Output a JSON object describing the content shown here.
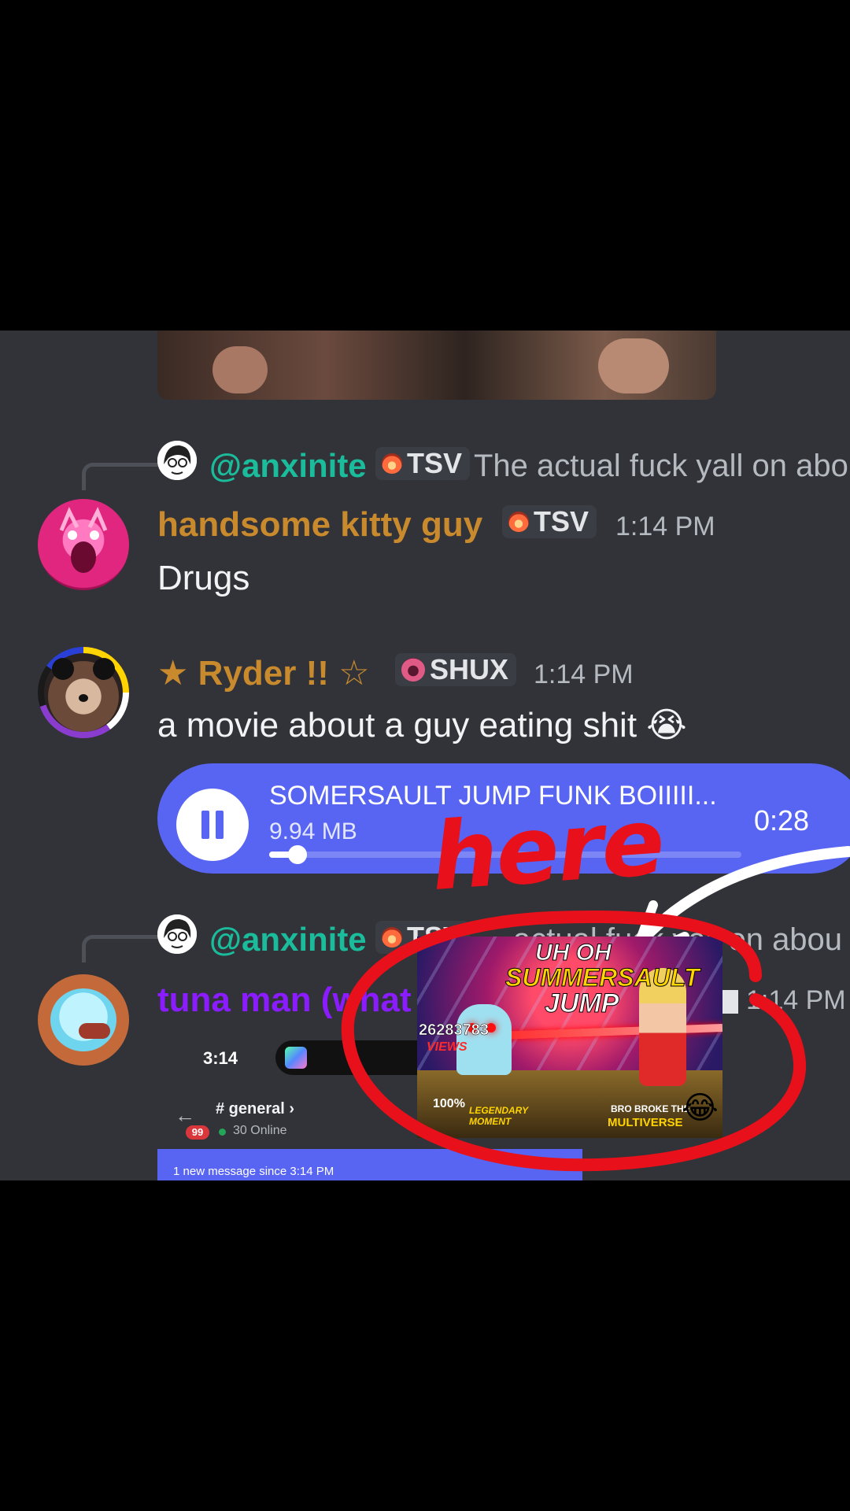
{
  "messages": {
    "reply1": {
      "name": "@anxinite",
      "tag": "TSV",
      "text": "The actual fuck yall on abou"
    },
    "kitty": {
      "name": "handsome kitty guy",
      "tag": "TSV",
      "time": "1:14 PM",
      "text": "Drugs"
    },
    "ryder": {
      "name": "★ Ryder !! ☆",
      "tag": "SHUX",
      "time": "1:14 PM",
      "text": "a movie about a guy eating shit 😭"
    },
    "audio": {
      "title": "SOMERSAULT JUMP FUNK BOIIIII...",
      "size": "9.94 MB",
      "duration": "0:28",
      "progress": 0.06
    },
    "reply2": {
      "name": "@anxinite",
      "tag": "TSV",
      "text": "actual fuck yall on abou"
    },
    "tuna": {
      "name": "tuna man (what",
      "time": "1:14 PM"
    }
  },
  "embedded_screenshot": {
    "time": "3:14",
    "channel": "# general ›",
    "badge": "99",
    "online": "30 Online",
    "banner": "1 new message since 3:14 PM"
  },
  "overlay": {
    "annotation": "here",
    "thumbnail": {
      "title_line1": "UH OH",
      "title_line2": "SUMMERSAULT",
      "title_line3": "JUMP",
      "views": "26283783",
      "views_label": "VIEWS",
      "percent": "100%",
      "legendary": "LEGENDARY MOMENT",
      "caption_top": "BRO BROKE THE",
      "caption_bottom": "MULTIVERSE",
      "emoji": "😂"
    }
  },
  "colors": {
    "bg": "#313338",
    "reply_name": "#1abc9c",
    "gold_name": "#c98a2e",
    "purple_name": "#8a1cff",
    "audio": "#5865f2",
    "annotation": "#e8101a"
  }
}
